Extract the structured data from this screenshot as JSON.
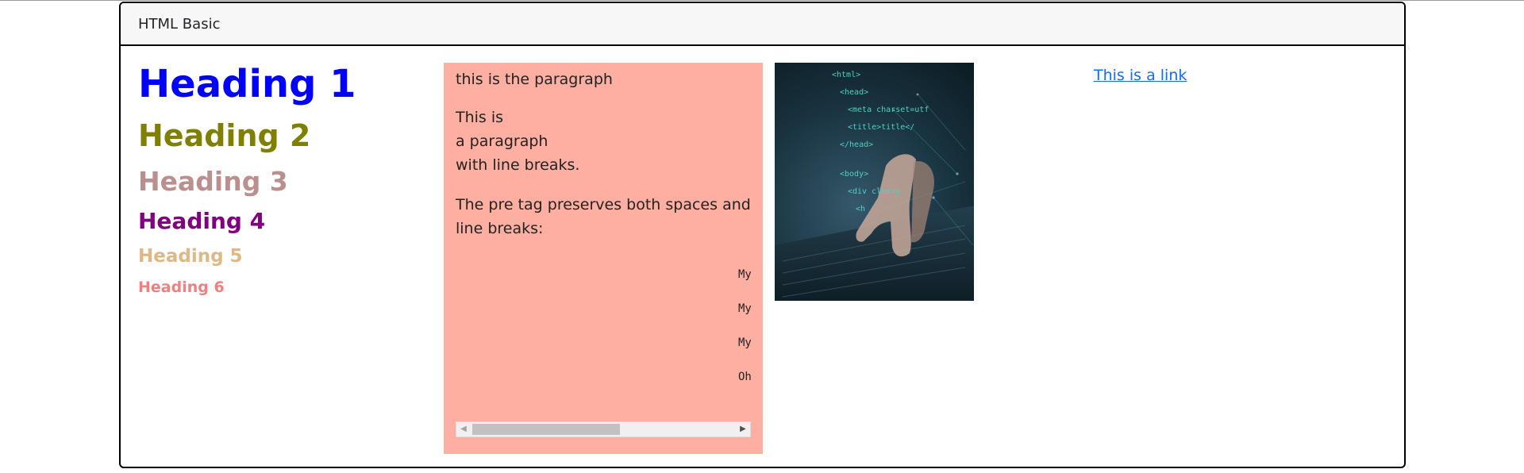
{
  "header": {
    "title": "HTML Basic"
  },
  "headings": [
    {
      "text": "Heading 1",
      "color": "#0000ff"
    },
    {
      "text": "Heading 2",
      "color": "#808000"
    },
    {
      "text": "Heading 3",
      "color": "#bc8f8f"
    },
    {
      "text": "Heading 4",
      "color": "#800080"
    },
    {
      "text": "Heading 5",
      "color": "#deb887"
    },
    {
      "text": "Heading 6",
      "color": "#f08080"
    }
  ],
  "content": {
    "paragraph1": "this is the paragraph",
    "paragraph2_lines": [
      "This is",
      "a paragraph",
      "with line breaks."
    ],
    "paragraph3": "The pre tag preserves both spaces and line breaks:",
    "pre_lines": [
      "My",
      "My",
      "My",
      "Oh"
    ],
    "box_color": "#ffafa1"
  },
  "image": {
    "icon": "code-laptop-image",
    "code_lines": [
      "<html>",
      "<head>",
      "<meta charset=utf",
      "<title>title</",
      "</head>",
      "<body>",
      "<div class=",
      "<h"
    ]
  },
  "link": {
    "text": "This is a link",
    "color": "#0d6efd"
  }
}
